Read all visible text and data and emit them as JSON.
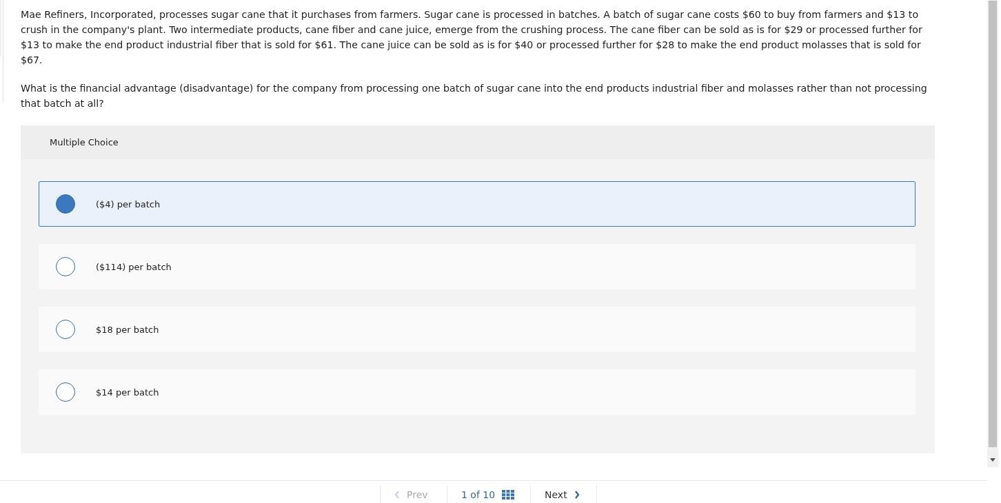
{
  "question": {
    "paragraphs": [
      "Mae Refiners, Incorporated, processes sugar cane that it purchases from farmers. Sugar cane is processed in batches. A batch of sugar cane costs $60 to buy from farmers and $13 to crush in the company's plant. Two intermediate products, cane fiber and cane juice, emerge from the crushing process. The cane fiber can be sold as is for $29 or processed further for $13 to make the end product industrial fiber that is sold for $61. The cane juice can be sold as is for $40 or processed further for $28 to make the end product molasses that is sold for $67.",
      "What is the financial advantage (disadvantage) for the company from processing one batch of sugar cane into the end products industrial fiber and molasses rather than not processing that batch at all?"
    ]
  },
  "multiple_choice": {
    "heading": "Multiple Choice",
    "options": [
      {
        "label": "($4) per batch",
        "selected": true
      },
      {
        "label": "($114) per batch",
        "selected": false
      },
      {
        "label": "$18 per batch",
        "selected": false
      },
      {
        "label": "$14 per batch",
        "selected": false
      }
    ]
  },
  "pager": {
    "prev": "Prev",
    "position": "1 of 10",
    "next": "Next"
  }
}
